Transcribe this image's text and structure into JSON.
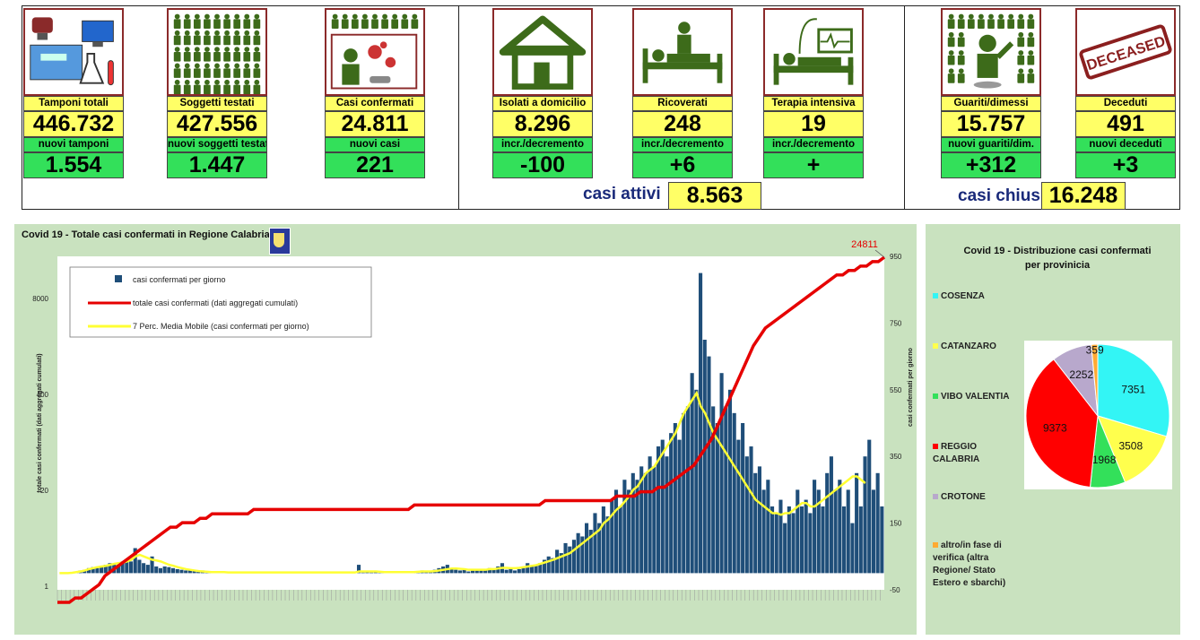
{
  "cards": [
    {
      "id": "tamponi",
      "icon": "laboratory-icon",
      "label": "Tamponi totali",
      "value": "446.732",
      "sublabel": "nuovi tamponi",
      "subvalue": "1.554"
    },
    {
      "id": "soggetti",
      "icon": "people-grid-icon",
      "label": "Soggetti testati",
      "value": "427.556",
      "sublabel": "nuovi soggetti testati",
      "subvalue": "1.447"
    },
    {
      "id": "casi",
      "icon": "virus-person-icon",
      "label": "Casi confermati",
      "value": "24.811",
      "sublabel": "nuovi casi",
      "subvalue": "221"
    },
    {
      "id": "isolati",
      "icon": "house-icon",
      "label": "Isolati a domicilio",
      "value": "8.296",
      "sublabel": "incr./decremento",
      "subvalue": "-100"
    },
    {
      "id": "ricoverati",
      "icon": "hospital-bed-icon",
      "label": "Ricoverati",
      "value": "248",
      "sublabel": "incr./decremento",
      "subvalue": "+6"
    },
    {
      "id": "terapia",
      "icon": "intensive-care-icon",
      "label": "Terapia intensiva",
      "value": "19",
      "sublabel": "incr./decremento",
      "subvalue": "+"
    },
    {
      "id": "guariti",
      "icon": "recovered-person-icon",
      "label": "Guariti/dimessi",
      "value": "15.757",
      "sublabel": "nuovi guariti/dim.",
      "subvalue": "+312"
    },
    {
      "id": "deceduti",
      "icon": "deceased-stamp-icon",
      "label": "Deceduti",
      "value": "491",
      "sublabel": "nuovi deceduti",
      "subvalue": "+3"
    }
  ],
  "deceased_stamp": "DECEASED",
  "totals": {
    "attivi_label": "casi attivi",
    "attivi_value": "8.563",
    "chiusi_label": "casi chiusi",
    "chiusi_value": "16.248"
  },
  "colors": {
    "yellow": "#ffff66",
    "green": "#33e05a",
    "bars": "#1f4e79",
    "cumulative": "#e60000",
    "moving_avg": "#ffff33",
    "panel_bg": "#c9e2bf"
  },
  "chart_data": [
    {
      "type": "bar",
      "title": "Covid 19 - Totale casi confermati in Regione Calabria",
      "ylabel_left": "totale casi confermati (dati aggregati cumulati)",
      "ylabel_right": "casi confermati per giorno",
      "yticks_left": [
        "1",
        "20",
        "400",
        "8000"
      ],
      "yticks_right": [
        "-50",
        "150",
        "350",
        "550",
        "750",
        "950"
      ],
      "y_right_range": [
        -50,
        950
      ],
      "y_left_scale": "log",
      "last_value_label": "24811",
      "legend_position": "top-left",
      "series": [
        {
          "name": "casi confermati per giorno",
          "type": "bar",
          "color": "#1f4e79"
        },
        {
          "name": "totale casi confermati (dati aggregati cumulati)",
          "type": "line",
          "color": "#e60000"
        },
        {
          "name": "7 Perc. Media Mobile (casi confermati per giorno)",
          "type": "line",
          "color": "#ffff33"
        }
      ],
      "daily_profile": [
        0,
        0,
        0,
        1,
        1,
        2,
        3,
        4,
        6,
        7,
        8,
        9,
        10,
        11,
        12,
        13,
        14,
        15,
        16,
        17,
        17,
        18,
        18,
        18,
        19,
        19,
        20,
        20,
        20,
        20,
        20,
        20,
        20,
        21,
        21,
        21,
        21,
        21,
        21,
        21,
        21,
        21,
        21,
        21,
        21,
        21,
        21,
        21,
        21,
        21,
        21,
        21,
        21,
        21,
        21,
        21,
        21,
        21,
        21,
        21,
        22,
        22,
        22,
        22,
        22,
        22,
        22,
        22,
        22,
        22,
        22,
        22,
        22,
        22,
        22,
        22,
        22,
        22,
        22,
        22,
        22,
        22,
        23,
        23,
        23,
        23,
        23,
        23,
        23,
        23,
        23,
        23,
        23,
        23,
        24,
        24,
        24,
        24,
        25,
        25,
        25,
        26,
        26,
        27,
        28,
        29,
        30,
        31,
        33,
        35,
        37,
        40,
        43,
        46,
        49,
        52,
        55,
        58,
        60,
        62,
        63,
        64,
        65,
        66,
        67,
        68,
        69,
        70,
        71,
        72,
        73,
        74,
        74,
        75,
        75,
        76,
        76,
        77,
        77,
        78
      ],
      "daily_values": [
        0,
        0,
        0,
        2,
        5,
        8,
        10,
        15,
        18,
        20,
        22,
        25,
        30,
        28,
        25,
        35,
        40,
        35,
        75,
        40,
        30,
        25,
        50,
        20,
        15,
        20,
        18,
        15,
        12,
        10,
        8,
        10,
        8,
        6,
        8,
        5,
        4,
        3,
        3,
        4,
        3,
        2,
        3,
        2,
        2,
        3,
        2,
        2,
        3,
        2,
        2,
        2,
        3,
        2,
        2,
        2,
        3,
        2,
        2,
        3,
        2,
        3,
        2,
        2,
        3,
        3,
        2,
        3,
        2,
        3,
        3,
        25,
        2,
        3,
        2,
        3,
        3,
        2,
        3,
        3,
        3,
        2,
        3,
        3,
        3,
        5,
        8,
        5,
        3,
        10,
        15,
        20,
        25,
        15,
        10,
        8,
        10,
        5,
        8,
        12,
        10,
        8,
        15,
        10,
        20,
        30,
        10,
        15,
        8,
        12,
        20,
        30,
        20,
        25,
        30,
        40,
        50,
        45,
        70,
        60,
        90,
        80,
        100,
        120,
        110,
        150,
        130,
        180,
        150,
        200,
        170,
        220,
        250,
        200,
        280,
        250,
        300,
        280,
        320,
        300,
        350,
        320,
        380,
        400,
        350,
        420,
        450,
        400,
        480,
        500,
        600,
        550,
        900,
        700,
        650,
        500,
        450,
        600,
        500,
        550,
        480,
        400,
        450,
        350,
        380,
        300,
        320,
        250,
        280,
        200,
        180,
        220,
        150,
        200,
        180,
        250,
        200,
        220,
        180,
        280,
        250,
        200,
        300,
        350,
        250,
        280,
        200,
        250,
        150,
        300,
        200,
        350,
        400,
        250,
        300,
        200
      ],
      "avg_values": [
        0,
        0,
        0,
        1,
        3,
        5,
        8,
        12,
        15,
        18,
        20,
        22,
        25,
        28,
        30,
        32,
        35,
        40,
        50,
        55,
        50,
        45,
        40,
        38,
        35,
        30,
        25,
        22,
        18,
        15,
        12,
        10,
        8,
        6,
        5,
        4,
        3,
        3,
        3,
        3,
        2,
        2,
        2,
        2,
        2,
        2,
        2,
        2,
        2,
        2,
        2,
        2,
        2,
        2,
        2,
        2,
        2,
        2,
        2,
        2,
        2,
        2,
        2,
        2,
        2,
        2,
        2,
        2,
        2,
        2,
        2,
        5,
        5,
        5,
        5,
        5,
        4,
        3,
        3,
        3,
        3,
        3,
        3,
        3,
        3,
        4,
        5,
        5,
        5,
        6,
        8,
        10,
        12,
        14,
        14,
        13,
        12,
        10,
        10,
        10,
        10,
        10,
        12,
        12,
        14,
        16,
        16,
        15,
        15,
        16,
        18,
        20,
        22,
        24,
        28,
        32,
        36,
        40,
        45,
        50,
        55,
        60,
        70,
        80,
        90,
        100,
        110,
        120,
        130,
        150,
        160,
        175,
        190,
        200,
        215,
        230,
        250,
        260,
        280,
        300,
        310,
        320,
        340,
        360,
        380,
        400,
        420,
        450,
        480,
        500,
        520,
        540,
        500,
        480,
        450,
        420,
        400,
        380,
        360,
        340,
        320,
        300,
        280,
        260,
        240,
        220,
        210,
        200,
        190,
        180,
        180,
        175,
        180,
        180,
        190,
        200,
        210,
        210,
        200,
        200,
        210,
        220,
        230,
        240,
        250,
        260,
        270,
        280,
        290,
        290,
        280,
        270
      ]
    },
    {
      "type": "pie",
      "title": "Covid 19 - Distribuzione casi confermati per provinicia",
      "legend_position": "left",
      "categories": [
        "COSENZA",
        "CATANZARO",
        "VIBO VALENTIA",
        "REGGIO CALABRIA",
        "CROTONE",
        "altro/in fase di verifica (altra Regione/ Stato Estero e sbarchi)"
      ],
      "values": [
        7351,
        3508,
        1968,
        9373,
        2252,
        359
      ],
      "colors": [
        "#33f5f5",
        "#ffff4d",
        "#33e05a",
        "#ff0000",
        "#b8a8cc",
        "#ffaa33"
      ]
    }
  ]
}
